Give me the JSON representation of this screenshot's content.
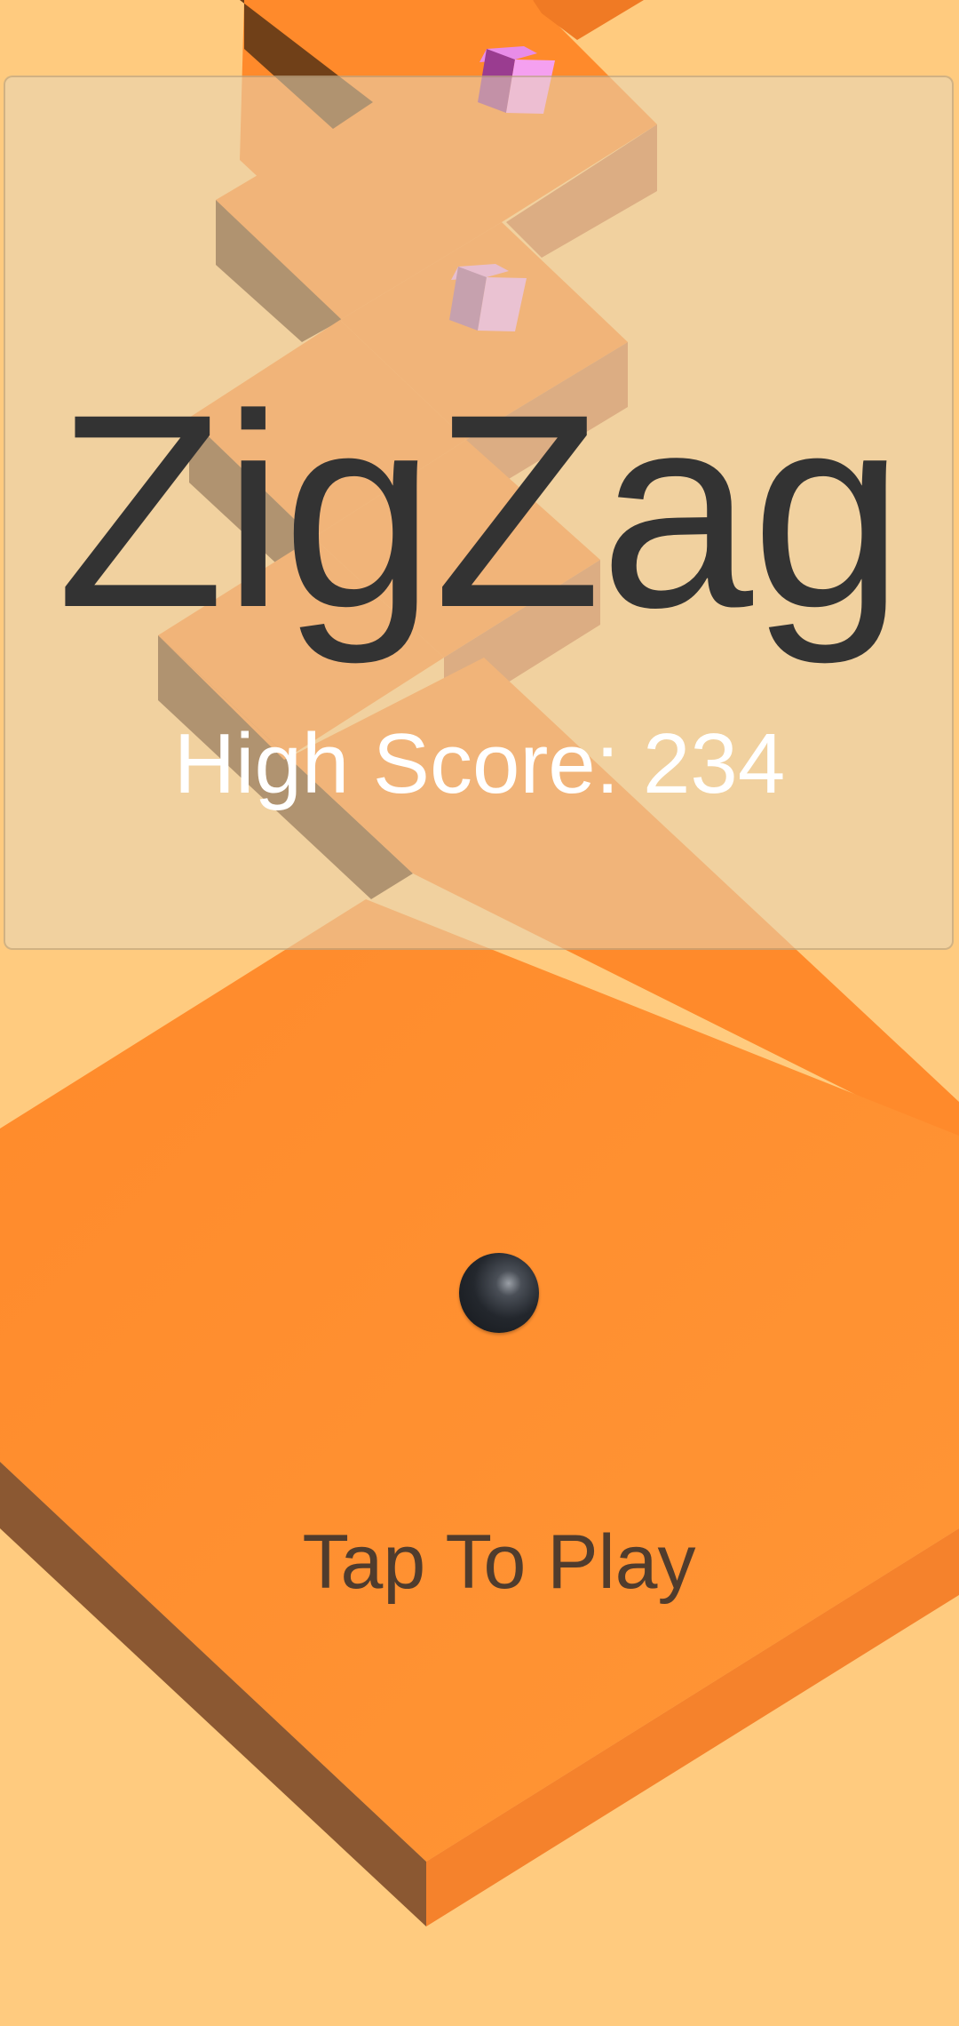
{
  "title": "ZigZag",
  "high_score": {
    "label": "High Score:",
    "value": "234"
  },
  "prompt": "Tap To Play",
  "colors": {
    "background": "#FFCB7F",
    "platform_top": "#FF8A2B",
    "platform_side_left": "#8B5832",
    "platform_side_right": "#F5822C",
    "gem": "#F5A0F0",
    "ball": "#1E2228",
    "title_text": "#333333",
    "score_text": "#FFFFFF",
    "prompt_text": "#503C2D"
  },
  "icons": {
    "ball": "ball-icon",
    "gem": "gem-icon"
  }
}
